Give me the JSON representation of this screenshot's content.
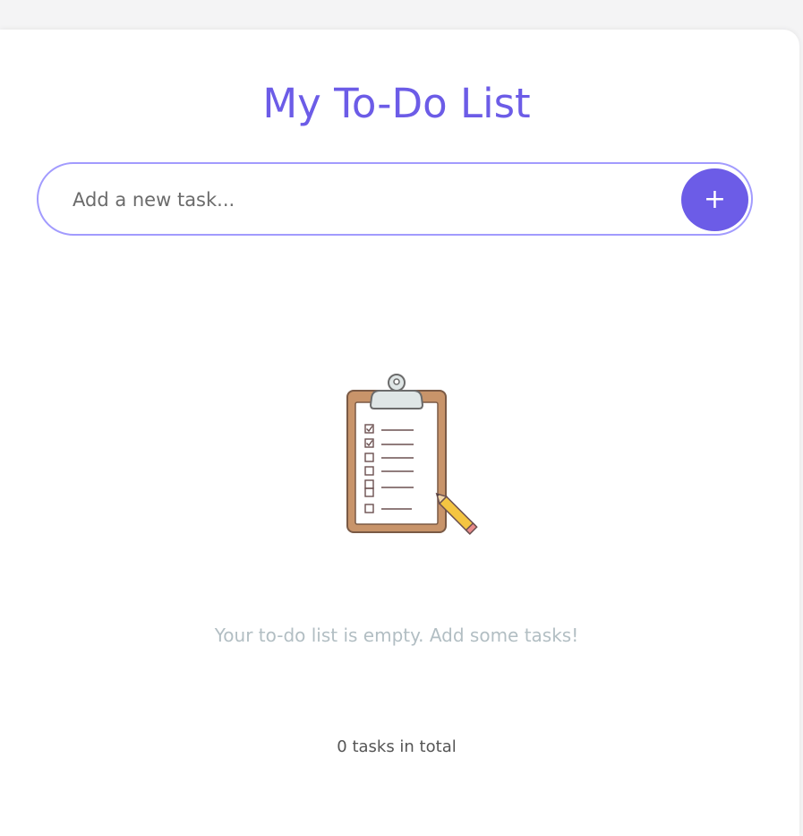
{
  "header": {
    "title": "My To-Do List"
  },
  "add_task": {
    "placeholder": "Add a new task...",
    "value": "",
    "button_label": "+"
  },
  "empty_state": {
    "icon": "clipboard-checklist-icon",
    "message": "Your to-do list is empty. Add some tasks!"
  },
  "footer": {
    "count_text": "0 tasks in total"
  },
  "colors": {
    "accent": "#6c5ce7",
    "input_border": "#a29bfe",
    "muted_text": "#b2bec3"
  }
}
